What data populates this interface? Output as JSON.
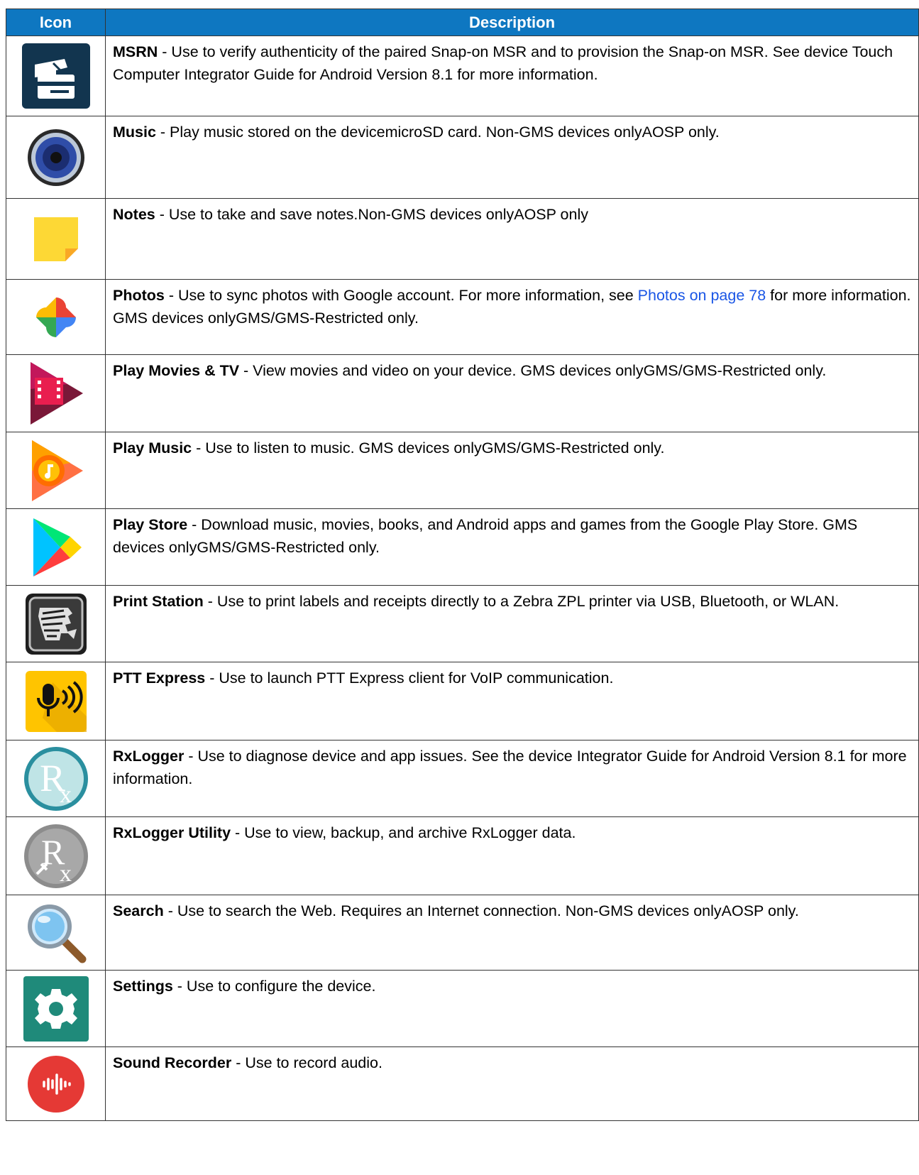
{
  "headers": {
    "icon": "Icon",
    "description": "Description"
  },
  "rows": [
    {
      "icon": "msrn-icon",
      "name": "MSRN",
      "text": " - Use to verify authenticity of the paired Snap-on MSR and to provision the Snap-on MSR. See device Touch Computer Integrator Guide for Android Version 8.1 for more information."
    },
    {
      "icon": "music-speaker-icon",
      "name": "Music",
      "text": " - Play music stored on the devicemicroSD card. Non-GMS devices onlyAOSP only."
    },
    {
      "icon": "notes-icon",
      "name": "Notes",
      "text": " - Use to take and save notes.Non-GMS devices onlyAOSP only"
    },
    {
      "icon": "photos-pinwheel-icon",
      "name": "Photos",
      "text_before": " - Use to sync photos with Google account. For more information, see ",
      "link": "Photos on page 78",
      "text_after": " for more information. GMS devices onlyGMS/GMS-Restricted only."
    },
    {
      "icon": "play-movies-icon",
      "name": "Play Movies & TV",
      "text": " - View movies and video on your device. GMS devices onlyGMS/GMS-Restricted only."
    },
    {
      "icon": "play-music-icon",
      "name": "Play Music",
      "text": " - Use to listen to music. GMS devices onlyGMS/GMS-Restricted only."
    },
    {
      "icon": "play-store-icon",
      "name": "Play Store",
      "text": " - Download music, movies, books, and Android apps and games from the Google Play Store. GMS devices onlyGMS/GMS-Restricted only."
    },
    {
      "icon": "zebra-print-station-icon",
      "name": "Print Station",
      "text": " - Use to print labels and receipts directly to a Zebra ZPL printer via USB, Bluetooth, or WLAN."
    },
    {
      "icon": "ptt-express-icon",
      "name": "PTT Express",
      "text": " - Use to launch PTT Express client for VoIP communication."
    },
    {
      "icon": "rxlogger-icon",
      "name": "RxLogger",
      "text": " - Use to diagnose device and app issues. See the device Integrator Guide for Android Version 8.1 for more information."
    },
    {
      "icon": "rxlogger-utility-icon",
      "name": "RxLogger Utility",
      "text": " - Use to view, backup, and archive RxLogger data."
    },
    {
      "icon": "search-magnifier-icon",
      "name": "Search",
      "text": " - Use to search the Web. Requires an Internet connection. Non-GMS devices onlyAOSP only."
    },
    {
      "icon": "settings-gear-icon",
      "name": "Settings",
      "text": " - Use to configure the device."
    },
    {
      "icon": "sound-recorder-icon",
      "name": "Sound Recorder",
      "text": " - Use to record audio."
    }
  ],
  "icon_glyphs": {
    "rx": "R",
    "rx_sub": "x"
  },
  "colors": {
    "header_bg": "#0e77c1",
    "link": "#1a56e6"
  }
}
